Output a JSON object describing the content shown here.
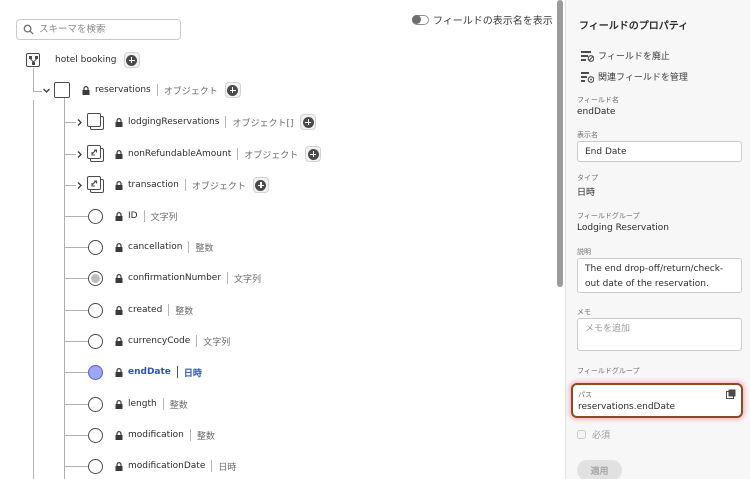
{
  "search": {
    "placeholder": "スキーマを検索"
  },
  "display_name_toggle": {
    "label": "フィールドの表示名を表示",
    "on": false
  },
  "tree": {
    "root": {
      "label": "hotel booking"
    },
    "reservations": {
      "name": "reservations",
      "type": "オブジェクト"
    },
    "children": [
      {
        "name": "lodgingReservations",
        "type": "オブジェクト[]"
      },
      {
        "name": "nonRefundableAmount",
        "type": "オブジェクト"
      },
      {
        "name": "transaction",
        "type": "オブジェクト"
      },
      {
        "name": "ID",
        "type": "文字列"
      },
      {
        "name": "cancellation",
        "type": "整数"
      },
      {
        "name": "confirmationNumber",
        "type": "文字列"
      },
      {
        "name": "created",
        "type": "整数"
      },
      {
        "name": "currencyCode",
        "type": "文字列"
      },
      {
        "name": "endDate",
        "type": "日時"
      },
      {
        "name": "length",
        "type": "整数"
      },
      {
        "name": "modification",
        "type": "整数"
      },
      {
        "name": "modificationDate",
        "type": "日時"
      }
    ]
  },
  "properties": {
    "title": "フィールドのプロパティ",
    "deprecate_action": "フィールドを廃止",
    "manage_related_action": "関連フィールドを管理",
    "field_name_label": "フィールド名",
    "field_name": "endDate",
    "display_name_label": "表示名",
    "display_name": "End Date",
    "type_label": "タイプ",
    "type": "日時",
    "field_group_label": "フィールドグループ",
    "field_group": "Lodging Reservation",
    "description_label": "説明",
    "description": "The end drop-off/return/check-out date of the reservation.",
    "note_label": "メモ",
    "note_placeholder": "メモを追加",
    "field_group_label_2": "フィールドグループ",
    "path_label": "パス",
    "path": "reservations.endDate",
    "required_label": "必須",
    "apply_button": "適用"
  }
}
